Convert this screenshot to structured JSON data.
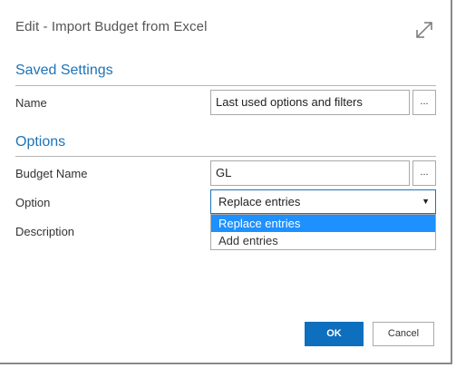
{
  "dialog": {
    "title": "Edit - Import Budget from Excel"
  },
  "saved_settings": {
    "heading": "Saved Settings",
    "name_label": "Name",
    "name_value": "Last used options and filters",
    "lookup_label": "..."
  },
  "options": {
    "heading": "Options",
    "budget_name_label": "Budget Name",
    "budget_name_value": "GL",
    "lookup_label": "...",
    "option_label": "Option",
    "option_value": "Replace entries",
    "option_choices": [
      "Replace entries",
      "Add entries"
    ],
    "description_label": "Description"
  },
  "buttons": {
    "ok": "OK",
    "cancel": "Cancel"
  },
  "colors": {
    "accent": "#1e73b7",
    "selected_option": "#1e90ff",
    "ok_button": "#0d6fbd"
  }
}
